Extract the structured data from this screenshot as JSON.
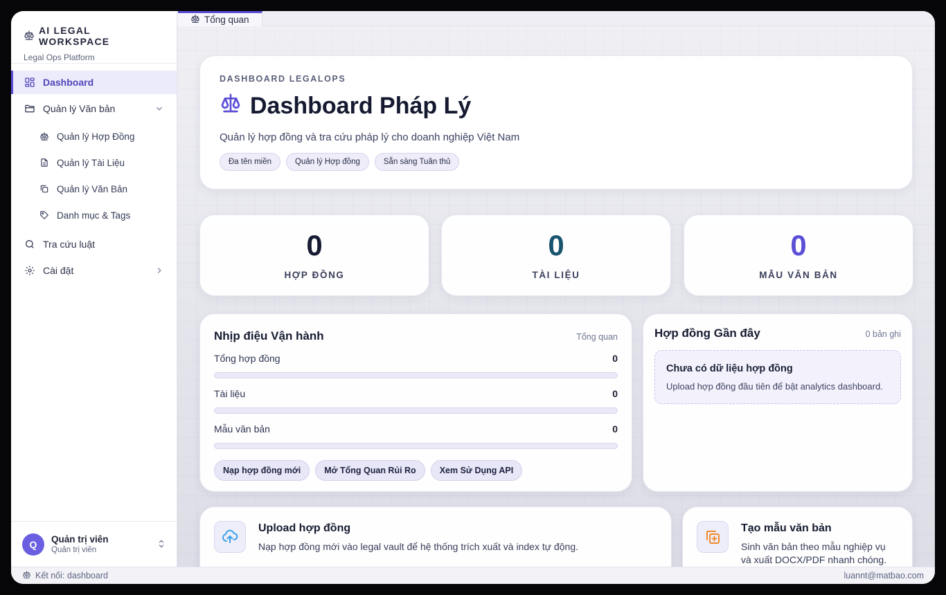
{
  "brand": {
    "title": "AI LEGAL WORKSPACE",
    "subtitle": "Legal Ops Platform"
  },
  "sidebar": {
    "items": [
      {
        "label": "Dashboard",
        "icon": "grid-icon"
      },
      {
        "label": "Quản lý Văn bản",
        "icon": "folder-icon"
      },
      {
        "label": "Quản lý Hợp Đồng",
        "icon": "scale-icon"
      },
      {
        "label": "Quản lý Tài Liệu",
        "icon": "file-icon"
      },
      {
        "label": "Quản lý Văn Bản",
        "icon": "copy-icon"
      },
      {
        "label": "Danh mục & Tags",
        "icon": "tag-icon"
      },
      {
        "label": "Tra cứu luật",
        "icon": "search-icon"
      },
      {
        "label": "Cài đặt",
        "icon": "gear-icon"
      }
    ]
  },
  "user": {
    "initial": "Q",
    "name": "Quản trị viên",
    "role": "Quản trị viên"
  },
  "tabs": [
    {
      "label": "Tổng quan"
    }
  ],
  "hero": {
    "eyebrow": "DASHBOARD LEGALOPS",
    "title": "Dashboard Pháp Lý",
    "subtitle": "Quản lý hợp đồng và tra cứu pháp lý cho doanh nghiệp Việt Nam",
    "chips": [
      "Đa tên miền",
      "Quản lý Hợp đồng",
      "Sẵn sàng Tuân thủ"
    ]
  },
  "stats": [
    {
      "value": "0",
      "label": "HỢP ĐỒNG",
      "color": "#171c33"
    },
    {
      "value": "0",
      "label": "TÀI LIỆU",
      "color": "#1a5570"
    },
    {
      "value": "0",
      "label": "MẪU VĂN BẢN",
      "color": "#5b4fd6"
    }
  ],
  "ops": {
    "title": "Nhịp điệu Vận hành",
    "tag": "Tổng quan",
    "metrics": [
      {
        "label": "Tổng hợp đồng",
        "value": "0",
        "progress": 0
      },
      {
        "label": "Tài liệu",
        "value": "0",
        "progress": 0
      },
      {
        "label": "Mẫu văn bản",
        "value": "0",
        "progress": 0
      }
    ],
    "buttons": [
      "Nạp hợp đồng mới",
      "Mở Tổng Quan Rủi Ro",
      "Xem Sử Dụng API"
    ]
  },
  "recent": {
    "title": "Hợp đồng Gần đây",
    "count": "0 bản ghi",
    "empty_title": "Chưa có dữ liệu hợp đồng",
    "empty_sub": "Upload hợp đồng đầu tiên để bật analytics dashboard."
  },
  "actions": [
    {
      "title": "Upload hợp đồng",
      "subtitle": "Nạp hợp đồng mới vào legal vault để hệ thống trích xuất và index tự động.",
      "icon": "upload-icon"
    },
    {
      "title": "Tạo mẫu văn bản",
      "subtitle": "Sinh văn bản theo mẫu nghiệp vụ và xuất DOCX/PDF nhanh chóng.",
      "icon": "copy-plus-icon"
    }
  ],
  "status": {
    "left": "Kết nối: dashboard",
    "right": "luannt@matbao.com"
  },
  "colors": {
    "accent": "#5b4fd6",
    "icon_orange": "#f08a2b",
    "icon_blue": "#3aa0e8"
  }
}
